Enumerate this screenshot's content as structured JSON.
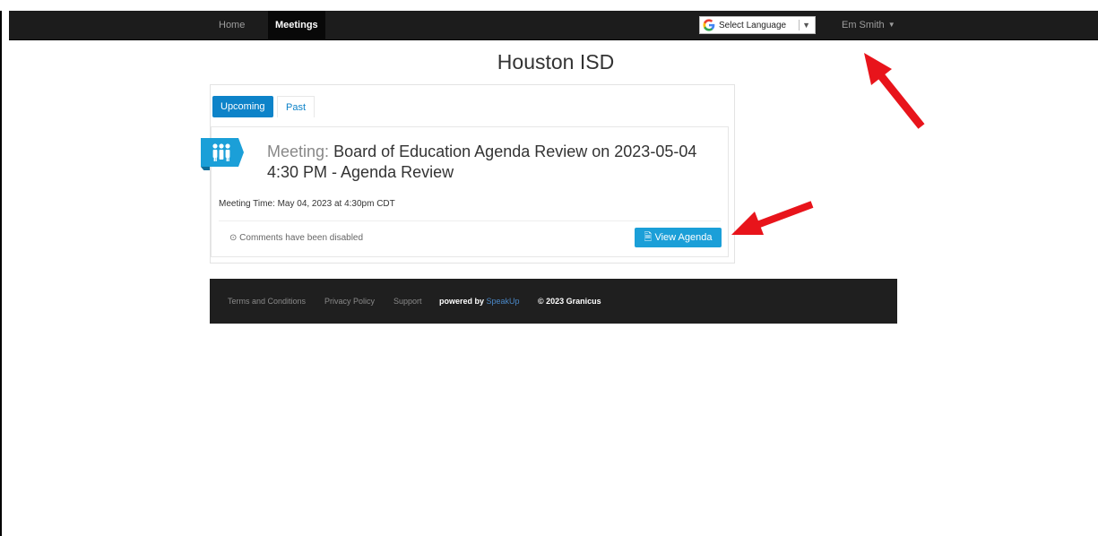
{
  "navbar": {
    "home": "Home",
    "meetings": "Meetings",
    "language": "Select Language",
    "language_caret": "▼",
    "user": "Em Smith"
  },
  "page_title": "Houston ISD",
  "tabs": [
    {
      "label": "Upcoming",
      "active": true
    },
    {
      "label": "Past",
      "active": false
    }
  ],
  "meeting": {
    "prefix": "Meeting:",
    "title": "Board of Education Agenda Review on 2023-05-04 4:30 PM - Agenda Review",
    "time": "Meeting Time: May 04, 2023 at 4:30pm CDT",
    "comments": "Comments have been disabled",
    "view_agenda": "View Agenda",
    "icon": "people-icon"
  },
  "footer": {
    "terms": "Terms and Conditions",
    "privacy": "Privacy Policy",
    "support": "Support",
    "powered_by": "powered by",
    "speakup": "SpeakUp",
    "copyright": "© 2023 Granicus"
  },
  "colors": {
    "accent": "#0d83c9",
    "button": "#1b9fd8",
    "navbar": "#1c1c1c",
    "annotation_arrow": "#e8141b"
  }
}
